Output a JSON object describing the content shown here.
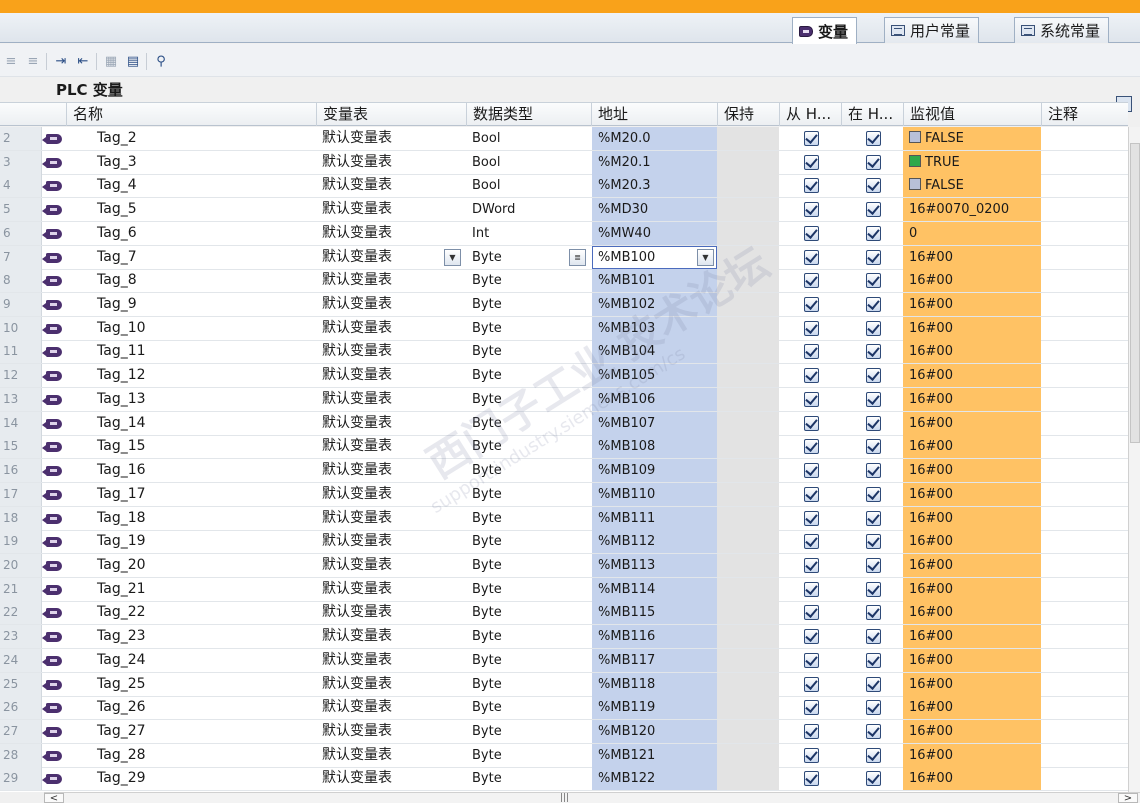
{
  "titlebar": {
    "text": ""
  },
  "tabs": [
    {
      "label": "变量",
      "active": true,
      "icon": "tag-table-icon"
    },
    {
      "label": "用户常量",
      "active": false,
      "icon": "user-constants-icon"
    },
    {
      "label": "系统常量",
      "active": false,
      "icon": "system-constants-icon"
    }
  ],
  "toolbar": {
    "buttons": [
      "add-row-icon",
      "insert-row-icon",
      "export-icon",
      "import-icon",
      "monitor-all-icon",
      "modify-icon",
      "preview-icon"
    ]
  },
  "plc_title": "PLC 变量",
  "columns": {
    "name": "名称",
    "table": "变量表",
    "type": "数据类型",
    "address": "地址",
    "retain": "保持",
    "accessible": "从 H...",
    "visible": "在 H...",
    "monitor": "监视值",
    "comment": "注释"
  },
  "rows": [
    {
      "n": "2",
      "name": "Tag_2",
      "table": "默认变量表",
      "type": "Bool",
      "address": "%M20.0",
      "monitor": "FALSE",
      "bool": "off"
    },
    {
      "n": "3",
      "name": "Tag_3",
      "table": "默认变量表",
      "type": "Bool",
      "address": "%M20.1",
      "monitor": "TRUE",
      "bool": "on"
    },
    {
      "n": "4",
      "name": "Tag_4",
      "table": "默认变量表",
      "type": "Bool",
      "address": "%M20.3",
      "monitor": "FALSE",
      "bool": "off"
    },
    {
      "n": "5",
      "name": "Tag_5",
      "table": "默认变量表",
      "type": "DWord",
      "address": "%MD30",
      "monitor": "16#0070_0200"
    },
    {
      "n": "6",
      "name": "Tag_6",
      "table": "默认变量表",
      "type": "Int",
      "address": "%MW40",
      "monitor": "0"
    },
    {
      "n": "7",
      "name": "Tag_7",
      "table": "默认变量表",
      "type": "Byte",
      "address": "%MB100",
      "monitor": "16#00",
      "editing": true
    },
    {
      "n": "8",
      "name": "Tag_8",
      "table": "默认变量表",
      "type": "Byte",
      "address": "%MB101",
      "monitor": "16#00"
    },
    {
      "n": "9",
      "name": "Tag_9",
      "table": "默认变量表",
      "type": "Byte",
      "address": "%MB102",
      "monitor": "16#00"
    },
    {
      "n": "10",
      "name": "Tag_10",
      "table": "默认变量表",
      "type": "Byte",
      "address": "%MB103",
      "monitor": "16#00"
    },
    {
      "n": "11",
      "name": "Tag_11",
      "table": "默认变量表",
      "type": "Byte",
      "address": "%MB104",
      "monitor": "16#00"
    },
    {
      "n": "12",
      "name": "Tag_12",
      "table": "默认变量表",
      "type": "Byte",
      "address": "%MB105",
      "monitor": "16#00"
    },
    {
      "n": "13",
      "name": "Tag_13",
      "table": "默认变量表",
      "type": "Byte",
      "address": "%MB106",
      "monitor": "16#00"
    },
    {
      "n": "14",
      "name": "Tag_14",
      "table": "默认变量表",
      "type": "Byte",
      "address": "%MB107",
      "monitor": "16#00"
    },
    {
      "n": "15",
      "name": "Tag_15",
      "table": "默认变量表",
      "type": "Byte",
      "address": "%MB108",
      "monitor": "16#00"
    },
    {
      "n": "16",
      "name": "Tag_16",
      "table": "默认变量表",
      "type": "Byte",
      "address": "%MB109",
      "monitor": "16#00"
    },
    {
      "n": "17",
      "name": "Tag_17",
      "table": "默认变量表",
      "type": "Byte",
      "address": "%MB110",
      "monitor": "16#00"
    },
    {
      "n": "18",
      "name": "Tag_18",
      "table": "默认变量表",
      "type": "Byte",
      "address": "%MB111",
      "monitor": "16#00"
    },
    {
      "n": "19",
      "name": "Tag_19",
      "table": "默认变量表",
      "type": "Byte",
      "address": "%MB112",
      "monitor": "16#00"
    },
    {
      "n": "20",
      "name": "Tag_20",
      "table": "默认变量表",
      "type": "Byte",
      "address": "%MB113",
      "monitor": "16#00"
    },
    {
      "n": "21",
      "name": "Tag_21",
      "table": "默认变量表",
      "type": "Byte",
      "address": "%MB114",
      "monitor": "16#00"
    },
    {
      "n": "22",
      "name": "Tag_22",
      "table": "默认变量表",
      "type": "Byte",
      "address": "%MB115",
      "monitor": "16#00"
    },
    {
      "n": "23",
      "name": "Tag_23",
      "table": "默认变量表",
      "type": "Byte",
      "address": "%MB116",
      "monitor": "16#00"
    },
    {
      "n": "24",
      "name": "Tag_24",
      "table": "默认变量表",
      "type": "Byte",
      "address": "%MB117",
      "monitor": "16#00"
    },
    {
      "n": "25",
      "name": "Tag_25",
      "table": "默认变量表",
      "type": "Byte",
      "address": "%MB118",
      "monitor": "16#00"
    },
    {
      "n": "26",
      "name": "Tag_26",
      "table": "默认变量表",
      "type": "Byte",
      "address": "%MB119",
      "monitor": "16#00"
    },
    {
      "n": "27",
      "name": "Tag_27",
      "table": "默认变量表",
      "type": "Byte",
      "address": "%MB120",
      "monitor": "16#00"
    },
    {
      "n": "28",
      "name": "Tag_28",
      "table": "默认变量表",
      "type": "Byte",
      "address": "%MB121",
      "monitor": "16#00"
    },
    {
      "n": "29",
      "name": "Tag_29",
      "table": "默认变量表",
      "type": "Byte",
      "address": "%MB122",
      "monitor": "16#00"
    }
  ],
  "watermark": {
    "line1": "西门子工业 技术论坛",
    "line2": "support.industry.siemens.com/cs"
  },
  "colors": {
    "titlebar": "#f9a21a",
    "monitor_bg": "#ffc264",
    "address_bg": "#c4d2ec",
    "retain_bg": "#e3e3e3",
    "tag_icon": "#4b2f6e"
  }
}
